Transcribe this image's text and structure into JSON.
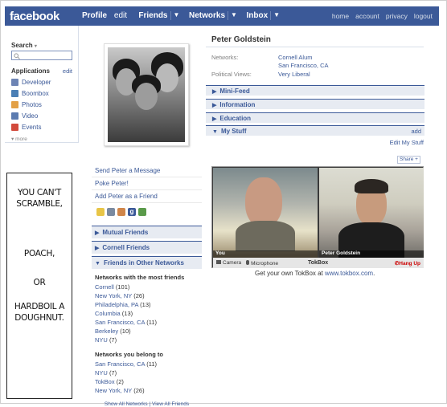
{
  "topbar": {
    "logo": "facebook",
    "nav": [
      {
        "label": "Profile",
        "bold": true
      },
      {
        "label": "edit",
        "bold": false
      },
      {
        "label": "Friends",
        "bold": true
      },
      {
        "label": "Networks",
        "bold": true
      },
      {
        "label": "Inbox",
        "bold": true
      }
    ],
    "right_links": [
      "home",
      "account",
      "privacy",
      "logout"
    ],
    "color": "#3b5998"
  },
  "sidebar": {
    "search_label": "Search",
    "applications_label": "Applications",
    "edit_label": "edit",
    "apps": [
      {
        "label": "Developer",
        "icon": "developer-icon",
        "color": "#6d84b4"
      },
      {
        "label": "Boombox",
        "icon": "boombox-icon",
        "color": "#4a7fb5"
      },
      {
        "label": "Photos",
        "icon": "photos-icon",
        "color": "#e3a046"
      },
      {
        "label": "Video",
        "icon": "video-icon",
        "color": "#5b7bb0"
      },
      {
        "label": "Events",
        "icon": "events-icon",
        "color": "#d24a3c"
      }
    ],
    "more": "more"
  },
  "poster": {
    "lines": [
      "YOU CAN'T",
      "SCRAMBLE,",
      "POACH,",
      "OR",
      "HARDBOIL A",
      "DOUGHNUT."
    ]
  },
  "profile": {
    "name": "Peter Goldstein",
    "networks_label": "Networks:",
    "networks": [
      "Cornell Alum",
      "San Francisco, CA"
    ],
    "political_label": "Political Views:",
    "political": "Very Liberal"
  },
  "left_links": [
    "Send Peter a Message",
    "Poke Peter!",
    "Add Peter as a Friend"
  ],
  "left_sections": {
    "mutual": "Mutual Friends",
    "cornell": "Cornell Friends",
    "other": "Friends in Other Networks",
    "most_friends_title": "Networks with the most friends",
    "most_friends": [
      {
        "name": "Cornell",
        "count": "(101)"
      },
      {
        "name": "New York, NY",
        "count": "(26)"
      },
      {
        "name": "Philadelphia, PA",
        "count": "(13)"
      },
      {
        "name": "Columbia",
        "count": "(13)"
      },
      {
        "name": "San Francisco, CA",
        "count": "(11)"
      },
      {
        "name": "Berkeley",
        "count": "(10)"
      },
      {
        "name": "NYU",
        "count": "(7)"
      }
    ],
    "belong_title": "Networks you belong to",
    "belong": [
      {
        "name": "San Francisco, CA",
        "count": "(11)"
      },
      {
        "name": "NYU",
        "count": "(7)"
      },
      {
        "name": "TokBox",
        "count": "(2)"
      },
      {
        "name": "New York, NY",
        "count": "(26)"
      }
    ],
    "show_all": "Show All Networks",
    "view_all": "View All Friends"
  },
  "right_sections": {
    "minifeed": "Mini-Feed",
    "information": "Information",
    "education": "Education",
    "mystuff": "My Stuff",
    "add": "add",
    "edit_mystuff": "Edit My Stuff",
    "share": "Share"
  },
  "tokbox": {
    "you_label": "You",
    "peer_label": "Peter Goldstein",
    "camera": "Camera",
    "microphone": "Microphone",
    "title": "TokBox",
    "hangup": "Hang Up",
    "get_own_prefix": "Get your own TokBox at",
    "get_own_link": "www.tokbox.com",
    "get_own_suffix": "."
  }
}
